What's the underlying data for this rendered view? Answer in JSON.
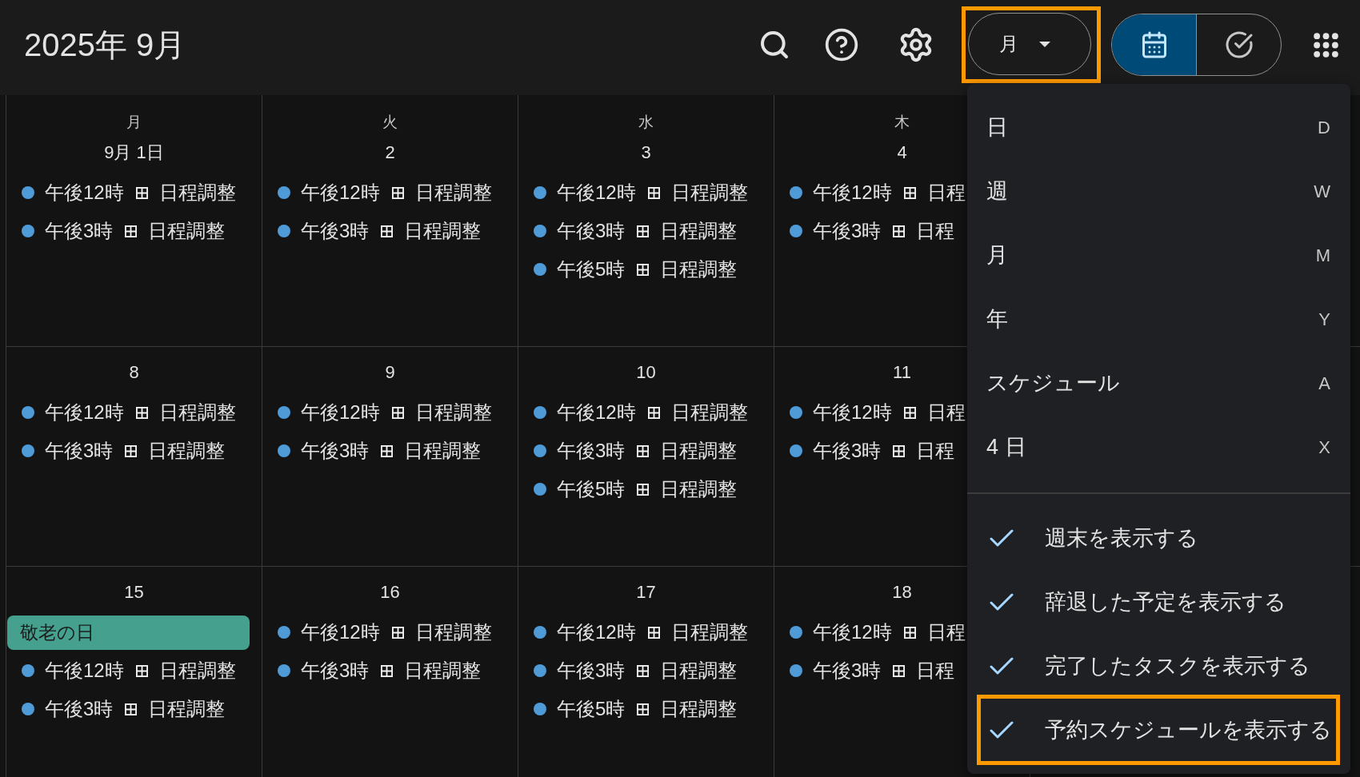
{
  "header": {
    "title": "2025年 9月",
    "view_button": {
      "label": "月",
      "highlighted": true
    },
    "mode_toggle": [
      {
        "kind": "calendar",
        "selected": true
      },
      {
        "kind": "tasks",
        "selected": false
      }
    ]
  },
  "calendar": {
    "weekdays": [
      "月",
      "火",
      "水",
      "木"
    ],
    "weeks": [
      {
        "days": [
          {
            "date": "9月 1日",
            "events": [
              {
                "time": "午後12時",
                "title": "日程調整"
              },
              {
                "time": "午後3時",
                "title": "日程調整"
              }
            ]
          },
          {
            "date": "2",
            "events": [
              {
                "time": "午後12時",
                "title": "日程調整"
              },
              {
                "time": "午後3時",
                "title": "日程調整"
              }
            ]
          },
          {
            "date": "3",
            "events": [
              {
                "time": "午後12時",
                "title": "日程調整"
              },
              {
                "time": "午後3時",
                "title": "日程調整"
              },
              {
                "time": "午後5時",
                "title": "日程調整"
              }
            ]
          },
          {
            "date": "4",
            "events": [
              {
                "time": "午後12時",
                "title": "日程"
              },
              {
                "time": "午後3時",
                "title": "日程"
              }
            ]
          }
        ]
      },
      {
        "days": [
          {
            "date": "8",
            "events": [
              {
                "time": "午後12時",
                "title": "日程調整"
              },
              {
                "time": "午後3時",
                "title": "日程調整"
              }
            ]
          },
          {
            "date": "9",
            "events": [
              {
                "time": "午後12時",
                "title": "日程調整"
              },
              {
                "time": "午後3時",
                "title": "日程調整"
              }
            ]
          },
          {
            "date": "10",
            "events": [
              {
                "time": "午後12時",
                "title": "日程調整"
              },
              {
                "time": "午後3時",
                "title": "日程調整"
              },
              {
                "time": "午後5時",
                "title": "日程調整"
              }
            ]
          },
          {
            "date": "11",
            "events": [
              {
                "time": "午後12時",
                "title": "日程"
              },
              {
                "time": "午後3時",
                "title": "日程"
              }
            ]
          }
        ]
      },
      {
        "days": [
          {
            "date": "15",
            "all_day": [
              "敬老の日"
            ],
            "events": [
              {
                "time": "午後12時",
                "title": "日程調整"
              },
              {
                "time": "午後3時",
                "title": "日程調整"
              }
            ]
          },
          {
            "date": "16",
            "events": [
              {
                "time": "午後12時",
                "title": "日程調整"
              },
              {
                "time": "午後3時",
                "title": "日程調整"
              }
            ]
          },
          {
            "date": "17",
            "events": [
              {
                "time": "午後12時",
                "title": "日程調整"
              },
              {
                "time": "午後3時",
                "title": "日程調整"
              },
              {
                "time": "午後5時",
                "title": "日程調整"
              }
            ]
          },
          {
            "date": "18",
            "events": [
              {
                "time": "午後12時",
                "title": "日程"
              },
              {
                "time": "午後3時",
                "title": "日程"
              }
            ]
          }
        ]
      }
    ]
  },
  "view_menu": {
    "views": [
      {
        "label": "日",
        "shortcut": "D"
      },
      {
        "label": "週",
        "shortcut": "W"
      },
      {
        "label": "月",
        "shortcut": "M"
      },
      {
        "label": "年",
        "shortcut": "Y"
      },
      {
        "label": "スケジュール",
        "shortcut": "A"
      },
      {
        "label": "4 日",
        "shortcut": "X"
      }
    ],
    "options": [
      {
        "label": "週末を表示する",
        "checked": true,
        "highlighted": false
      },
      {
        "label": "辞退した予定を表示する",
        "checked": true,
        "highlighted": false
      },
      {
        "label": "完了したタスクを表示する",
        "checked": true,
        "highlighted": false
      },
      {
        "label": "予約スケジュールを表示する",
        "checked": true,
        "highlighted": true
      }
    ]
  }
}
